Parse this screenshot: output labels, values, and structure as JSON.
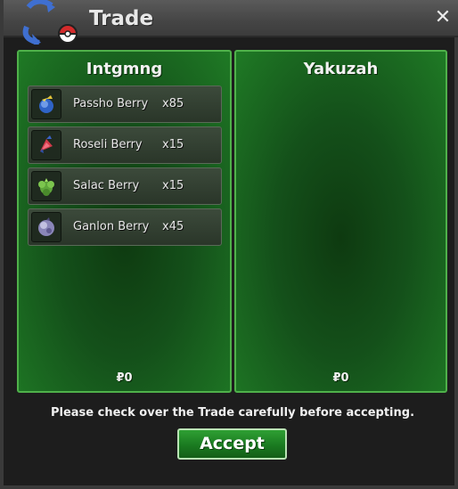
{
  "window": {
    "title": "Trade",
    "close_label": "✕"
  },
  "left_panel": {
    "player_name": "Intgmng",
    "money": "₽0",
    "items": [
      {
        "name": "Passho Berry",
        "quantity": "x85",
        "icon": "passho-berry-icon"
      },
      {
        "name": "Roseli Berry",
        "quantity": "x15",
        "icon": "roseli-berry-icon"
      },
      {
        "name": "Salac Berry",
        "quantity": "x15",
        "icon": "salac-berry-icon"
      },
      {
        "name": "Ganlon Berry",
        "quantity": "x45",
        "icon": "ganlon-berry-icon"
      }
    ]
  },
  "right_panel": {
    "player_name": "Yakuzah",
    "money": "₽0",
    "items": []
  },
  "footer": {
    "notice": "Please check over the Trade carefully before accepting.",
    "accept_label": "Accept"
  },
  "colors": {
    "panel_border": "#4fb14a",
    "panel_bg": "#14501a",
    "accept_bg": "#1a7a20"
  }
}
